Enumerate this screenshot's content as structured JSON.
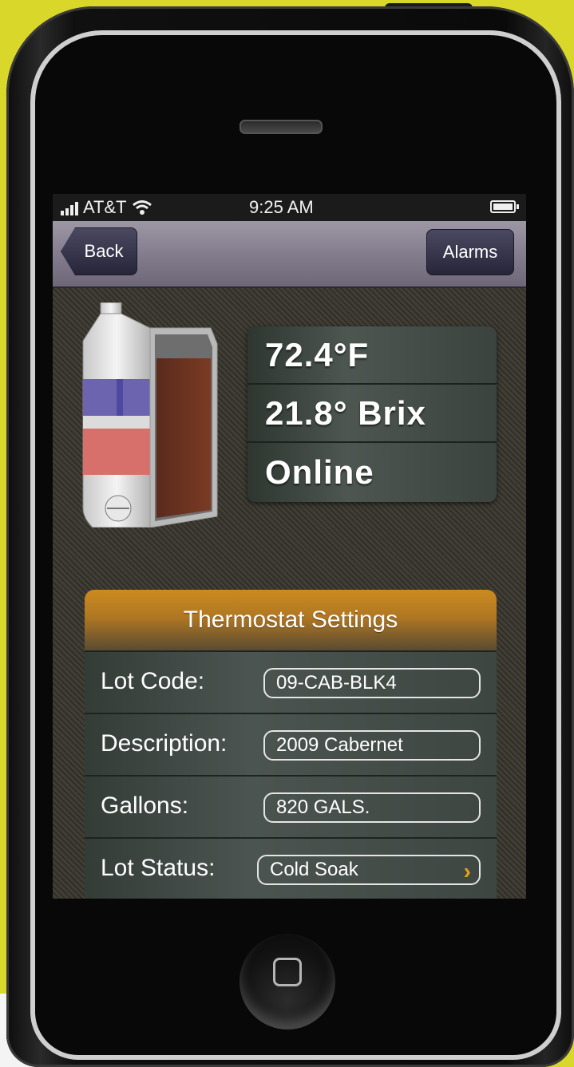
{
  "status_bar": {
    "carrier": "AT&T",
    "time": "9:25 AM"
  },
  "nav": {
    "back_label": "Back",
    "alarms_label": "Alarms"
  },
  "readouts": {
    "temperature": "72.4°F",
    "brix": "21.8° Brix",
    "status": "Online"
  },
  "thermostat": {
    "header": "Thermostat Settings",
    "rows": [
      {
        "label": "Lot Code:",
        "value": "09-CAB-BLK4"
      },
      {
        "label": "Description:",
        "value": "2009 Cabernet"
      },
      {
        "label": "Gallons:",
        "value": "820 GALS."
      },
      {
        "label": "Lot Status:",
        "value": "Cold Soak"
      }
    ]
  },
  "icons": [
    "signal-bars-icon",
    "wifi-icon",
    "battery-icon",
    "tank-icon",
    "chevron-right-icon",
    "home-button-icon"
  ],
  "colors": {
    "background": "#d9d82a",
    "nav_bar": "#837d8e",
    "settings_header": "#cc8a20",
    "chevron": "#e8a020"
  }
}
